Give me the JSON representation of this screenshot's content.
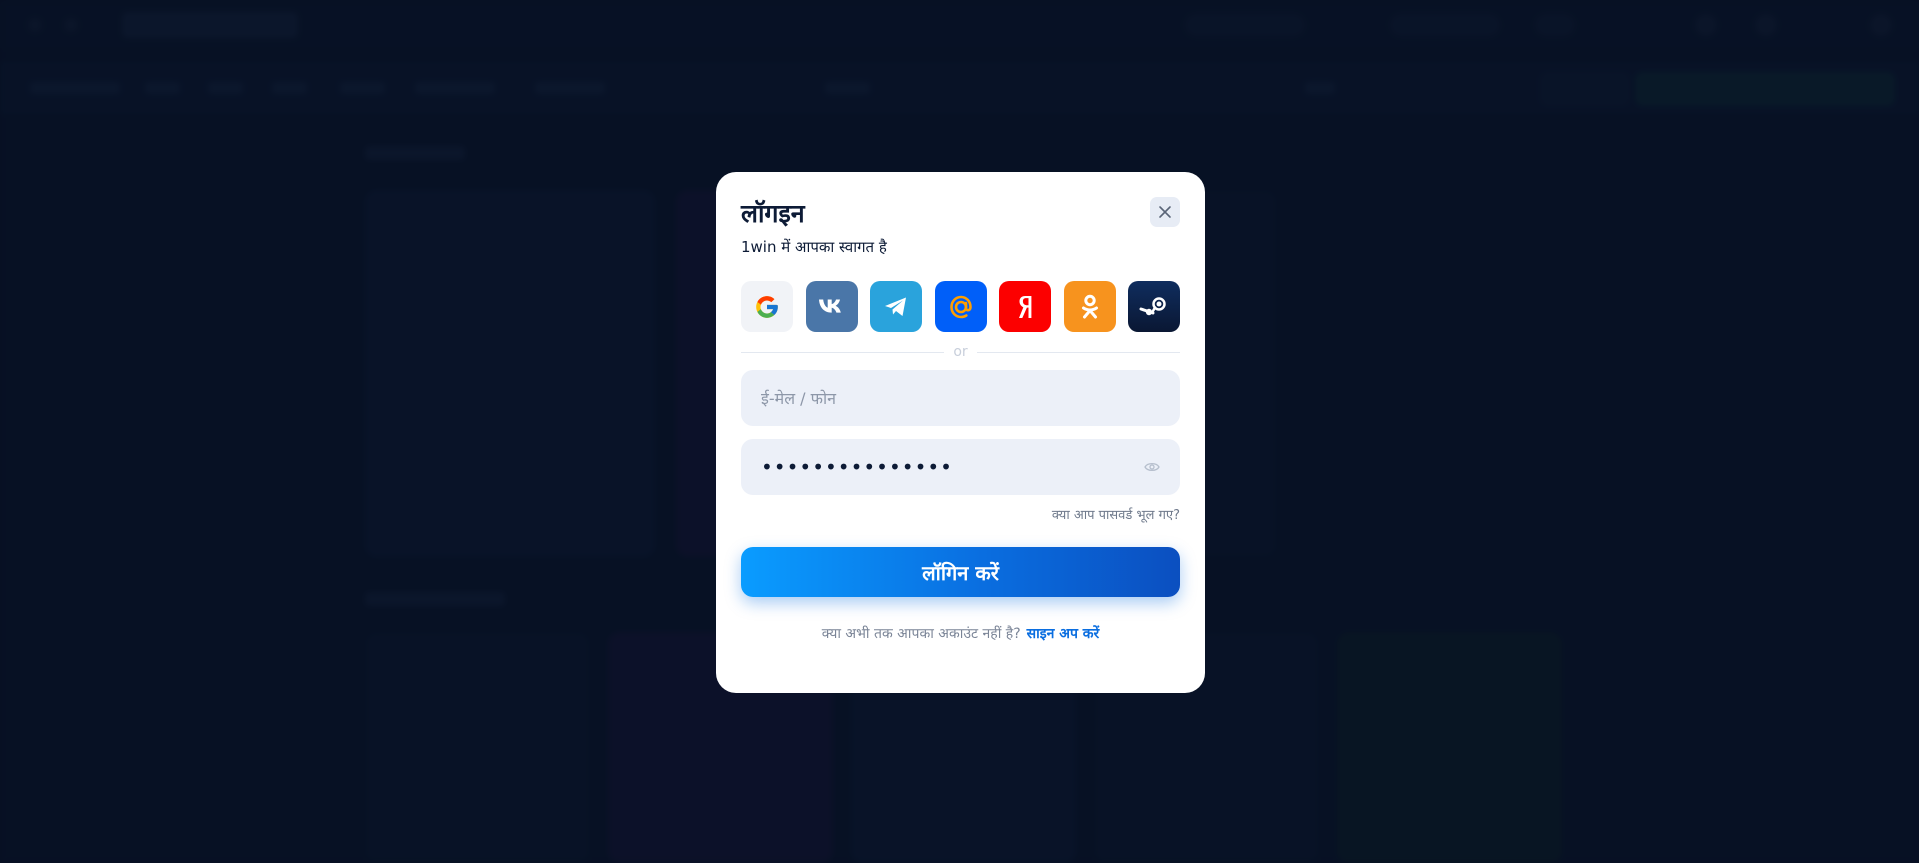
{
  "modal": {
    "title": "लॉगइन",
    "subtitle": "1win में आपका स्वागत है",
    "divider_text": "or",
    "email_field": {
      "placeholder": "ई-मेल / फोन",
      "value": ""
    },
    "password_field": {
      "value": "•••••••••••••••"
    },
    "forgot_password": "क्या आप पासवर्ड भूल गए?",
    "login_button": "लॉगिन करें",
    "signup_prompt": "क्या अभी तक आपका अकाउंट नहीं है?",
    "signup_link": "साइन अप करें"
  },
  "social_logins": [
    {
      "provider": "google",
      "icon": "google-icon",
      "bg_color": "#f1f3f7"
    },
    {
      "provider": "vk",
      "icon": "vk-icon",
      "bg_color": "#4a76a8"
    },
    {
      "provider": "telegram",
      "icon": "telegram-icon",
      "bg_color": "#2aa3dc"
    },
    {
      "provider": "mail.ru",
      "icon": "at-sign-icon",
      "bg_color": "#005ff9"
    },
    {
      "provider": "yandex",
      "icon": "yandex-icon",
      "bg_color": "#fc0000"
    },
    {
      "provider": "odnoklassniki",
      "icon": "ok-icon",
      "bg_color": "#f7931e"
    },
    {
      "provider": "steam",
      "icon": "steam-icon",
      "bg_color": "#0d2a5a"
    }
  ],
  "colors": {
    "accent": "#0a6ee0",
    "backdrop": "#0c1d3a",
    "input_bg": "#ecf0f8"
  }
}
